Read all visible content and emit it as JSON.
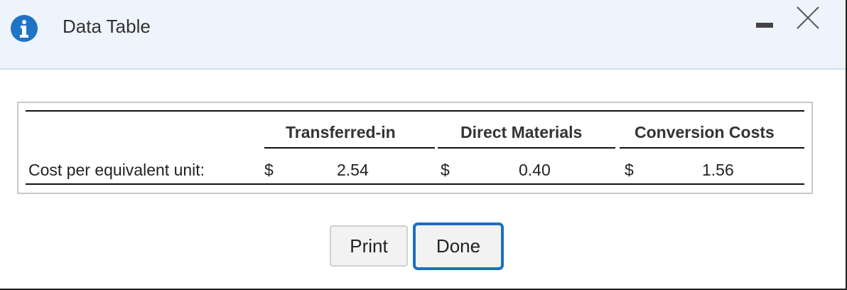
{
  "dialog": {
    "title": "Data Table",
    "icons": {
      "info": "info-icon",
      "minimize": "minimize-icon",
      "close": "close-icon"
    },
    "colors": {
      "info_icon": "#1f74c4",
      "titlebar_bg": "#eef4fb",
      "done_border": "#1f6fbf"
    }
  },
  "table": {
    "columns": [
      "Transferred-in",
      "Direct Materials",
      "Conversion Costs"
    ],
    "rows": [
      {
        "label": "Cost per equivalent unit:",
        "cells": [
          {
            "currency": "$",
            "value": "2.54"
          },
          {
            "currency": "$",
            "value": "0.40"
          },
          {
            "currency": "$",
            "value": "1.56"
          }
        ]
      }
    ]
  },
  "buttons": {
    "print": "Print",
    "done": "Done"
  }
}
